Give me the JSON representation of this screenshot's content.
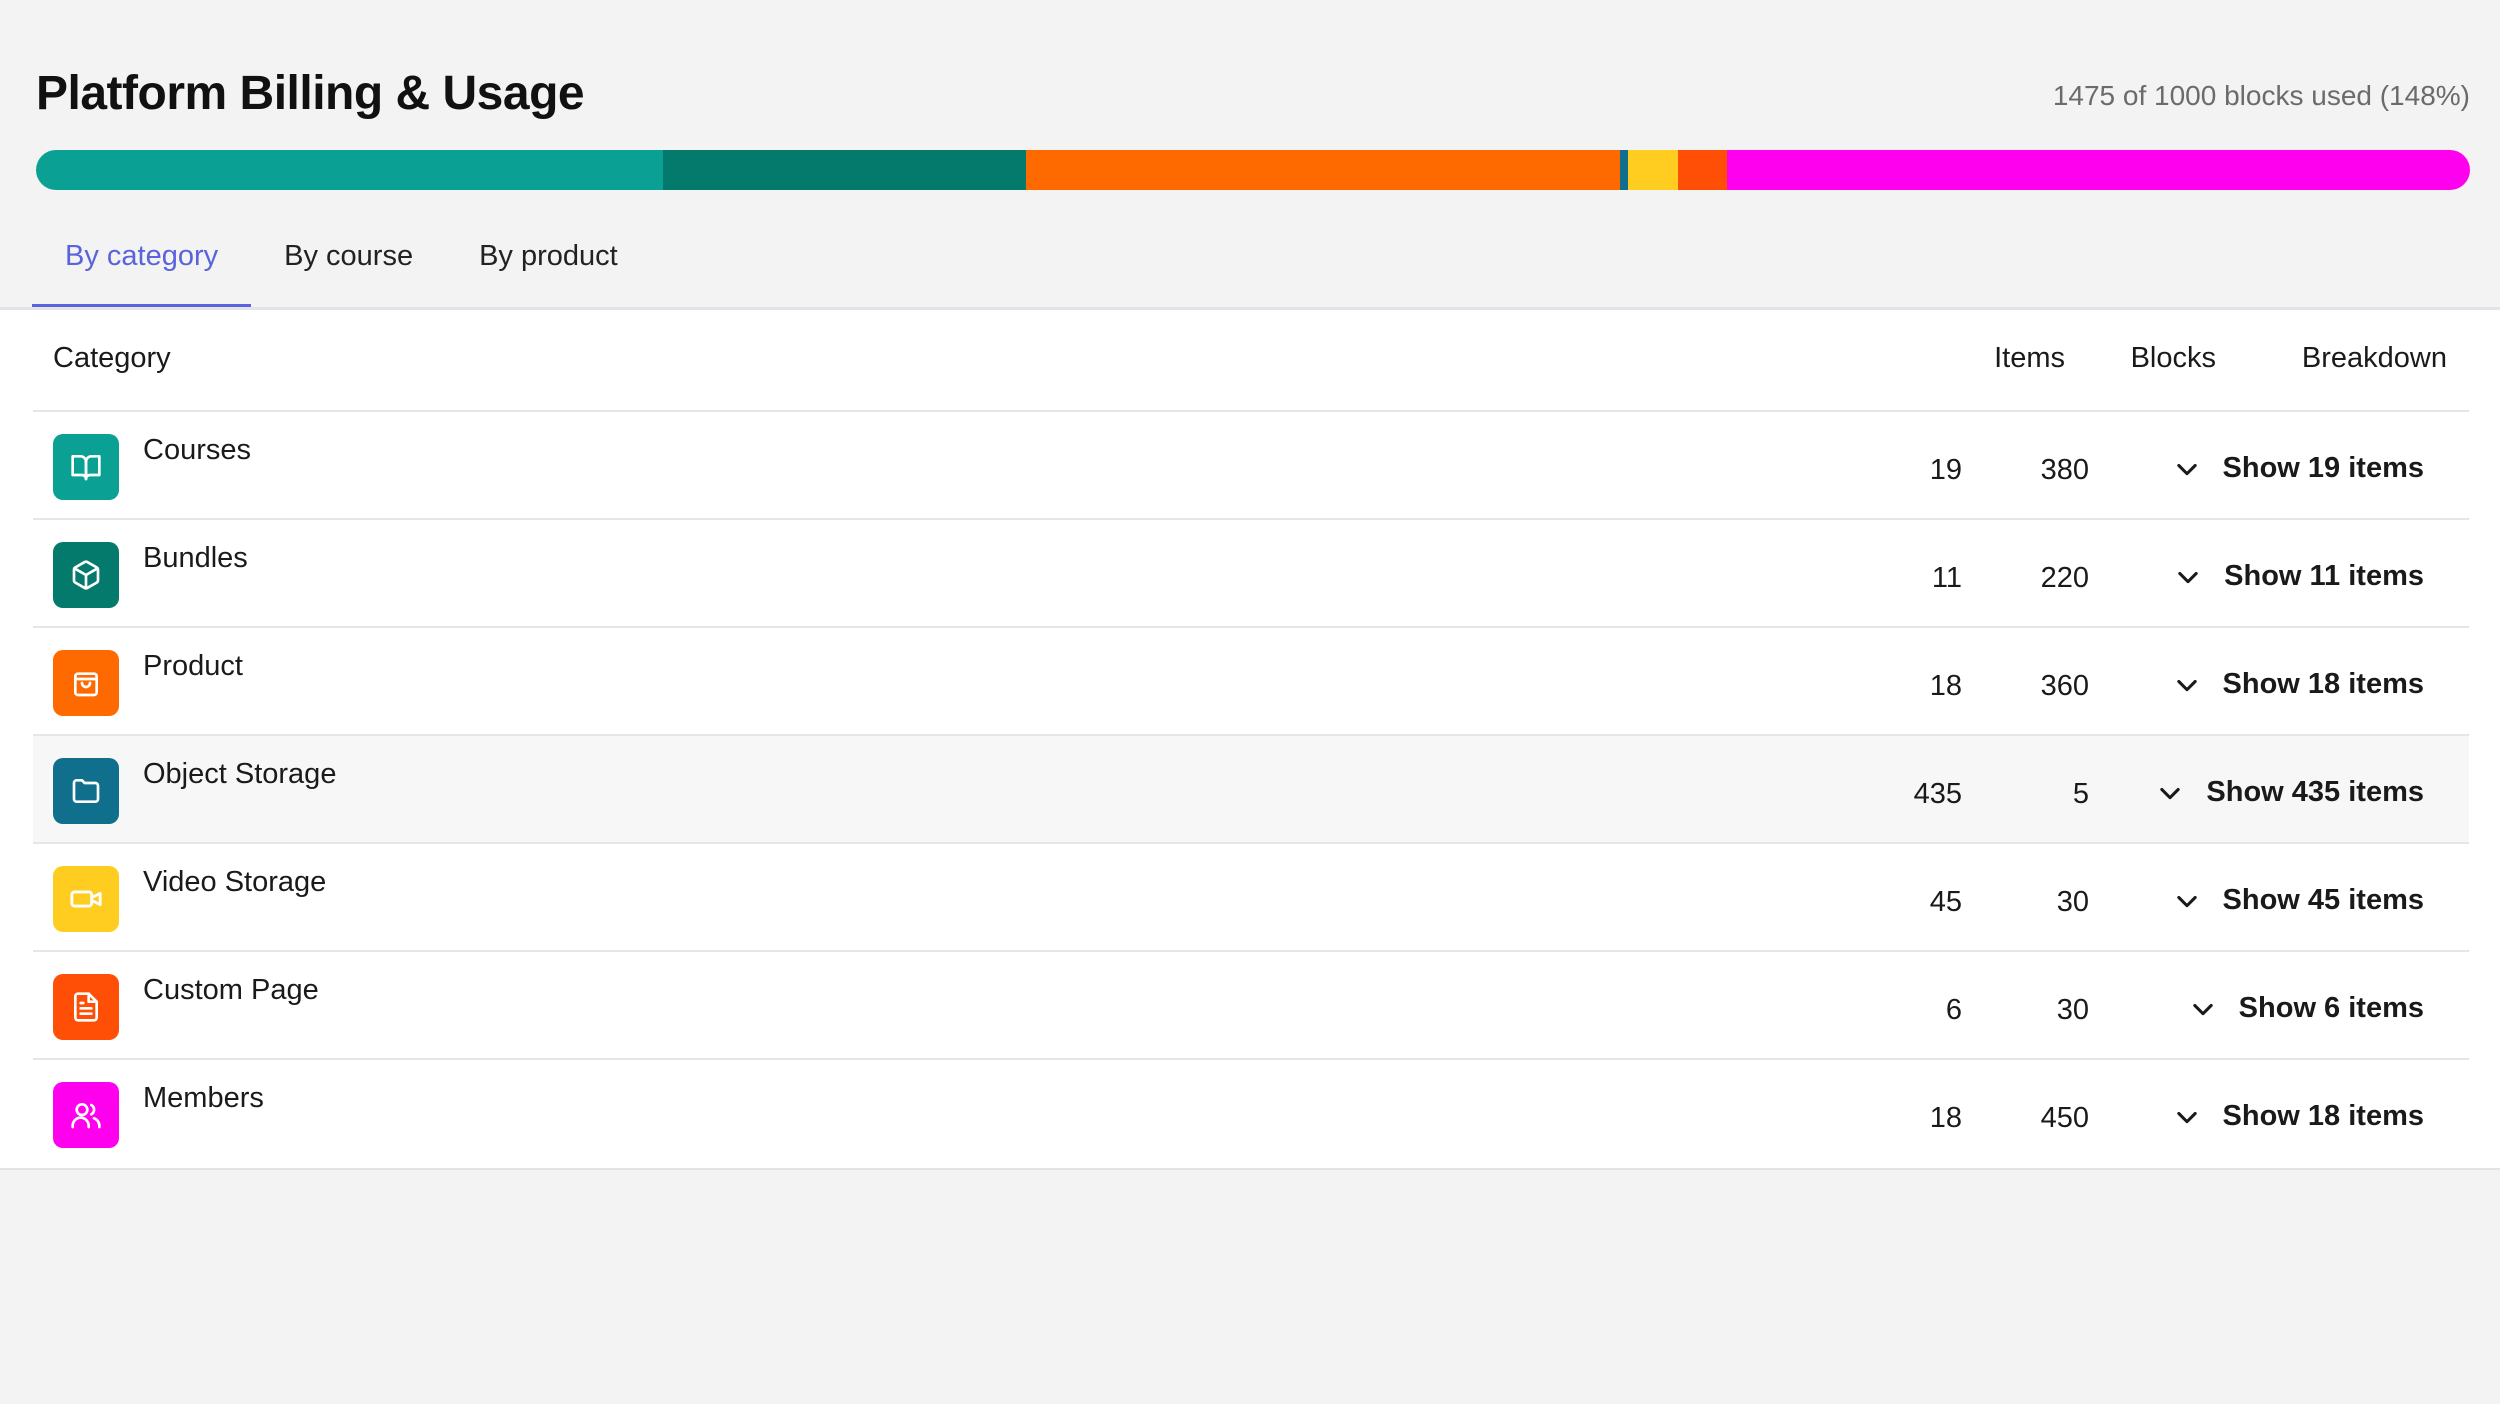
{
  "header": {
    "title": "Platform Billing & Usage",
    "usage_text": "1475 of 1000 blocks used (148%)"
  },
  "usage_bar": {
    "total_blocks": 1475,
    "segments": [
      {
        "name": "Courses",
        "blocks": 380,
        "color": "#0aa093"
      },
      {
        "name": "Bundles",
        "blocks": 220,
        "color": "#047a6d"
      },
      {
        "name": "Product",
        "blocks": 360,
        "color": "#ff6a00"
      },
      {
        "name": "Object Storage",
        "blocks": 5,
        "color": "#0f6f8c"
      },
      {
        "name": "Video Storage",
        "blocks": 30,
        "color": "#ffcd20"
      },
      {
        "name": "Custom Page",
        "blocks": 30,
        "color": "#ff4f07"
      },
      {
        "name": "Members",
        "blocks": 450,
        "color": "#ff00ee"
      }
    ]
  },
  "tabs": [
    {
      "label": "By category",
      "active": true
    },
    {
      "label": "By course",
      "active": false
    },
    {
      "label": "By product",
      "active": false
    }
  ],
  "table": {
    "headers": {
      "category": "Category",
      "items": "Items",
      "blocks": "Blocks",
      "breakdown": "Breakdown"
    },
    "rows": [
      {
        "category": "Courses",
        "icon": "book-icon",
        "color": "#0aa093",
        "items": "19",
        "blocks": "380",
        "breakdown": "Show 19 items"
      },
      {
        "category": "Bundles",
        "icon": "box-icon",
        "color": "#047a6d",
        "items": "11",
        "blocks": "220",
        "breakdown": "Show 11 items"
      },
      {
        "category": "Product",
        "icon": "shopping-bag-icon",
        "color": "#ff6a00",
        "items": "18",
        "blocks": "360",
        "breakdown": "Show 18 items"
      },
      {
        "category": "Object Storage",
        "icon": "folder-icon",
        "color": "#0f6f8c",
        "items": "435",
        "blocks": "5",
        "breakdown": "Show 435 items"
      },
      {
        "category": "Video Storage",
        "icon": "video-camera-icon",
        "color": "#ffcd20",
        "items": "45",
        "blocks": "30",
        "breakdown": "Show 45 items"
      },
      {
        "category": "Custom Page",
        "icon": "document-icon",
        "color": "#ff4f07",
        "items": "6",
        "blocks": "30",
        "breakdown": "Show 6 items"
      },
      {
        "category": "Members",
        "icon": "users-icon",
        "color": "#ff00ee",
        "items": "18",
        "blocks": "450",
        "breakdown": "Show 18 items"
      }
    ]
  }
}
